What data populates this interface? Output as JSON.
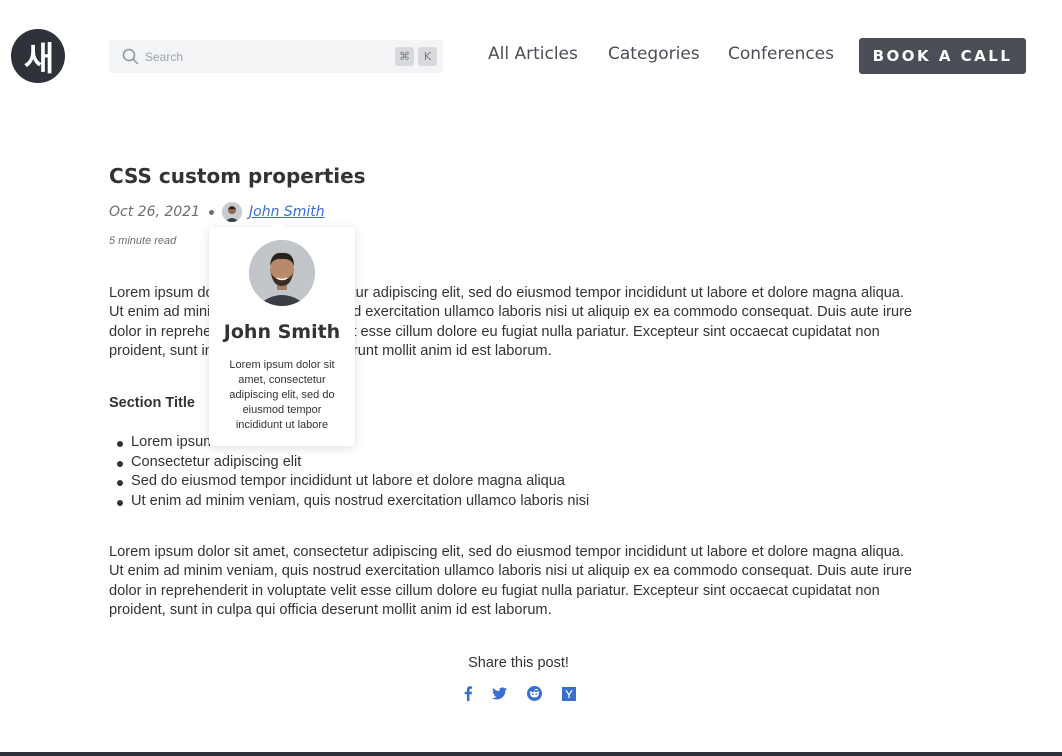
{
  "header": {
    "logo_text": "새",
    "search": {
      "placeholder": "Search",
      "shortcut_keys": [
        "⌘",
        "K"
      ]
    },
    "nav": [
      "All Articles",
      "Categories",
      "Conferences"
    ],
    "cta_label": "BOOK A CALL"
  },
  "article": {
    "title": "CSS custom properties",
    "date": "Oct 26, 2021",
    "author": "John Smith",
    "read_time": "5 minute read",
    "paragraph1": "Lorem ipsum dolor sit amet, consectetur adipiscing elit, sed do eiusmod tempor incididunt ut labore et dolore magna aliqua. Ut enim ad minim veniam, quis nostrud exercitation ullamco laboris nisi ut aliquip ex ea commodo consequat. Duis aute irure dolor in reprehenderit in voluptate velit esse cillum dolore eu fugiat nulla pariatur. Excepteur sint occaecat cupidatat non proident, sunt in culpa qui officia deserunt mollit anim id est laborum.",
    "section_title": "Section Title",
    "list_items": [
      "Lorem ipsum dolor sit amet",
      "Consectetur adipiscing elit",
      "Sed do eiusmod tempor incididunt ut labore et dolore magna aliqua",
      "Ut enim ad minim veniam, quis nostrud exercitation ullamco laboris nisi"
    ],
    "paragraph2": "Lorem ipsum dolor sit amet, consectetur adipiscing elit, sed do eiusmod tempor incididunt ut labore et dolore magna aliqua. Ut enim ad minim veniam, quis nostrud exercitation ullamco laboris nisi ut aliquip ex ea commodo consequat. Duis aute irure dolor in reprehenderit in voluptate velit esse cillum dolore eu fugiat nulla pariatur. Excepteur sint occaecat cupidatat non proident, sunt in culpa qui officia deserunt mollit anim id est laborum."
  },
  "author_popover": {
    "name": "John Smith",
    "bio": "Lorem ipsum dolor sit amet, consectetur adipiscing elit, sed do eiusmod tempor incididunt ut labore"
  },
  "share": {
    "label": "Share this post!",
    "icons": [
      "facebook-icon",
      "twitter-icon",
      "reddit-icon",
      "hacker-news-icon"
    ]
  },
  "colors": {
    "accent_link": "#3a6fd1",
    "cta_background": "#4b4e56",
    "logo_background": "#2d3339"
  }
}
